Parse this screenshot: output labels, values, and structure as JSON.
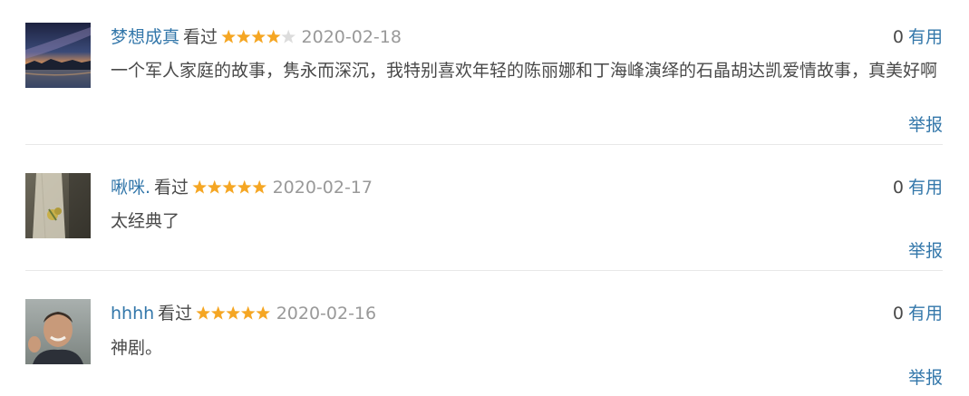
{
  "comments": [
    {
      "user": "梦想成真",
      "status": "看过",
      "rating_stars": 4,
      "max_stars": 5,
      "date": "2020-02-18",
      "votes": "0",
      "useful_label": "有用",
      "content": "一个军人家庭的故事，隽永而深沉，我特别喜欢年轻的陈丽娜和丁海峰演绎的石晶胡达凯爱情故事，真美好啊",
      "report_label": "举报"
    },
    {
      "user": "啾咪.",
      "status": "看过",
      "rating_stars": 5,
      "max_stars": 5,
      "date": "2020-02-17",
      "votes": "0",
      "useful_label": "有用",
      "content": "太经典了",
      "report_label": "举报"
    },
    {
      "user": "hhhh",
      "status": "看过",
      "rating_stars": 5,
      "max_stars": 5,
      "date": "2020-02-16",
      "votes": "0",
      "useful_label": "有用",
      "content": "神剧。",
      "report_label": "举报"
    }
  ],
  "colors": {
    "link": "#3377aa",
    "star_filled": "#f5a623",
    "star_empty": "#dcdcdc",
    "date": "#999999",
    "text": "#494949",
    "divider": "#e8e8e8"
  }
}
